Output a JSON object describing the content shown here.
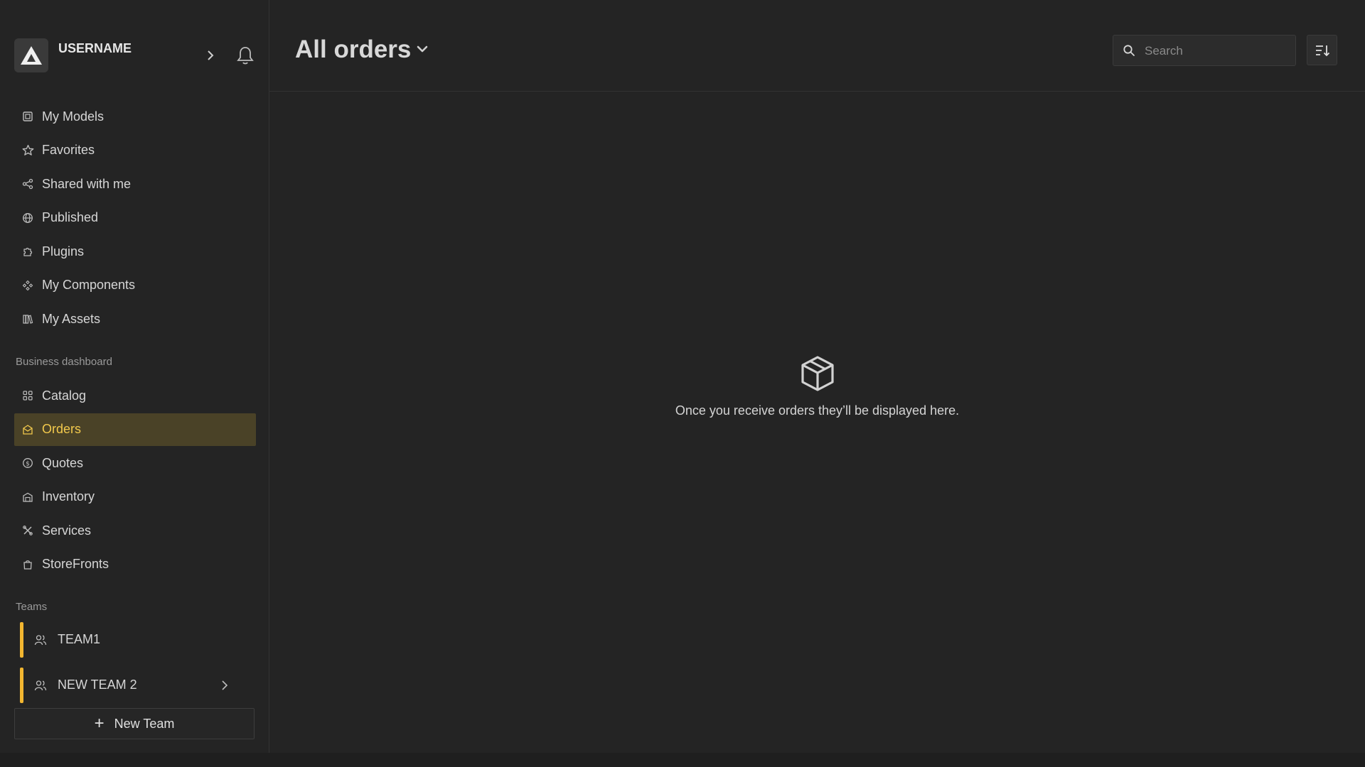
{
  "user": {
    "name": "USERNAME"
  },
  "nav_primary": [
    {
      "label": "My Models",
      "icon": "models-icon"
    },
    {
      "label": "Favorites",
      "icon": "star-icon"
    },
    {
      "label": "Shared with me",
      "icon": "share-icon"
    },
    {
      "label": "Published",
      "icon": "globe-icon"
    },
    {
      "label": "Plugins",
      "icon": "puzzle-icon"
    },
    {
      "label": "My Components",
      "icon": "components-icon"
    },
    {
      "label": "My Assets",
      "icon": "assets-icon"
    }
  ],
  "business": {
    "section_label": "Business dashboard",
    "items": [
      {
        "label": "Catalog",
        "icon": "grid-icon"
      },
      {
        "label": "Orders",
        "icon": "orders-icon",
        "active": true
      },
      {
        "label": "Quotes",
        "icon": "dollar-icon"
      },
      {
        "label": "Inventory",
        "icon": "warehouse-icon"
      },
      {
        "label": "Services",
        "icon": "tools-icon"
      },
      {
        "label": "StoreFronts",
        "icon": "bag-icon"
      }
    ]
  },
  "teams": {
    "section_label": "Teams",
    "items": [
      {
        "label": "TEAM1"
      },
      {
        "label": "NEW TEAM 2"
      }
    ],
    "new_team_label": "New Team"
  },
  "header": {
    "title": "All orders",
    "search_placeholder": "Search"
  },
  "empty_state": {
    "message": "Once you receive orders they’ll be displayed here."
  },
  "colors": {
    "accent": "#f2c94c",
    "active_bg": "#4a4227",
    "team_bar": "#f2b630",
    "background": "#242424"
  }
}
